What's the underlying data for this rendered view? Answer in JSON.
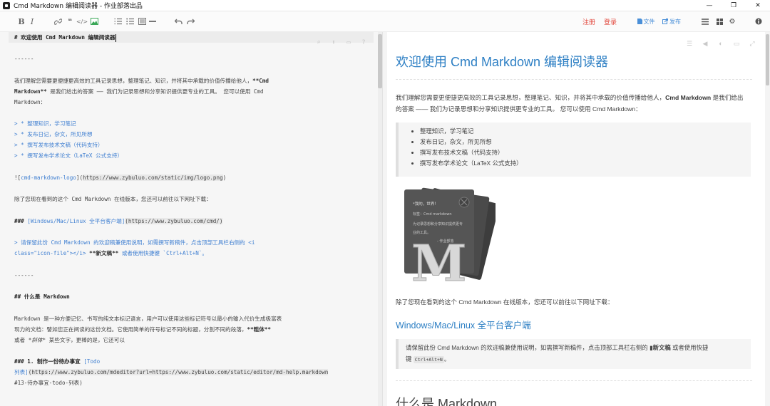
{
  "window": {
    "title": "Cmd Markdown 编辑阅读器 - 作业部落出品",
    "minimize": "—",
    "restore": "❐",
    "close": "✕"
  },
  "toolbar": {
    "bold": "B",
    "italic": "I",
    "register": "注册",
    "login": "登录",
    "file": "文件",
    "publish": "发布"
  },
  "editor": {
    "line1": "# 欢迎使用 Cmd Markdown 编辑阅读器",
    "line2": "------",
    "line3a": "我们理解您需要更便捷更高效的工具记录思想，整理笔记、知识，并将其中承载的价值传播给他人，",
    "line3b": "**Cmd",
    "line4a": "Markdown**",
    "line4b": " 是我们给出的答案 —— 我们为记录思想和分享知识提供更专业的工具。 您可以使用 Cmd",
    "line5": "Markdown：",
    "quote1": "> * 整理知识，学习笔记",
    "quote2": "> * 发布日记，杂文，所见所想",
    "quote3": "> * 撰写发布技术文稿（代码支持）",
    "quote4": "> * 撰写发布学术论文（LaTeX 公式支持）",
    "img_prefix": "![",
    "img_alt": "cmd-markdown-logo",
    "img_mid": "](",
    "img_url": "https://www.zybuluo.com/static/img/logo.png",
    "img_suffix": ")",
    "line_now": "除了您现在看到的这个 Cmd Markdown 在线版本，您还可以前往以下网址下载：",
    "h3_prefix": "### ",
    "h3_link": "[Windows/Mac/Linux 全平台客户端]",
    "h3_url": "(https://www.zybuluo.com/cmd/)",
    "quote5": "> 请保留此份 Cmd Markdown 的欢迎稿兼使用说明，如需撰写新稿件，点击顶部工具栏右侧的 <i",
    "quote6a": "class=\"icon-file\"></i>",
    "quote6b": " **新文稿** ",
    "quote6c": "或者使用快捷键 `Ctrl+Alt+N`。",
    "hr2": "------",
    "h2": "## 什么是 Markdown",
    "md1": "Markdown 是一种方便记忆、书写的纯文本标记语言，用户可以使用这些标记符号以最小的输入代价生成极富表",
    "md2a": "现力的文档：譬如您正在阅读的这份文档。它使用简单的符号标记不同的标题，分割不同的段落，",
    "md2b": "**粗体**",
    "md3a": "或者 ",
    "md3b": "*斜体*",
    "md3c": " 某些文字，更棒的是，它还可以",
    "h3b_a": "### 1. 制作一份待办事宜 ",
    "h3b_b": "[Todo",
    "todo1a": "列表]",
    "todo1b": "(https://www.zybuluo.com/mdeditor?url=https://www.zybuluo.com/static/editor/md-help.markdown",
    "todo2": "#13-待办事宜-todo-列表)"
  },
  "preview": {
    "h1": "欢迎使用 Cmd Markdown 编辑阅读器",
    "p1a": "我们理解您需要更便捷更高效的工具记录思想，整理笔记、知识，并将其中承载的价值传播给他人，",
    "p1b": "Cmd Markdown",
    "p1c": " 是我们给出的答案 —— 我们为记录思想和分享知识提供更专业的工具。 您可以使用 Cmd Markdown：",
    "list": [
      "整理知识，学习笔记",
      "发布日记，杂文，所见所想",
      "撰写发布技术文稿（代码支持）",
      "撰写发布学术论文（LaTeX 公式支持）"
    ],
    "logo_line1": "*我的，世界！",
    "logo_line2": "标签：Cmd markdown",
    "logo_line3": "为记录思想和分享知识提供更专",
    "logo_line4": "业的工具。",
    "logo_line5": "- 作业部落",
    "logo_letter": "M",
    "p2": "除了您现在看到的这个 Cmd Markdown 在线版本，您还可以前往以下网址下载：",
    "h3": "Windows/Mac/Linux 全平台客户端",
    "q2a": "请保留此份 Cmd Markdown 的欢迎稿兼使用说明，如需撰写新稿件，点击顶部工具栏右侧的",
    "q2b": "新文稿",
    "q2c": " 或者使用快捷",
    "q2d": "键 ",
    "q2kbd": "Ctrl+Alt+N",
    "q2e": "。",
    "h2_partial": "什么是 Markdown"
  },
  "colors": {
    "accent_blue": "#2d7fc4",
    "login_red": "#e2483e"
  }
}
